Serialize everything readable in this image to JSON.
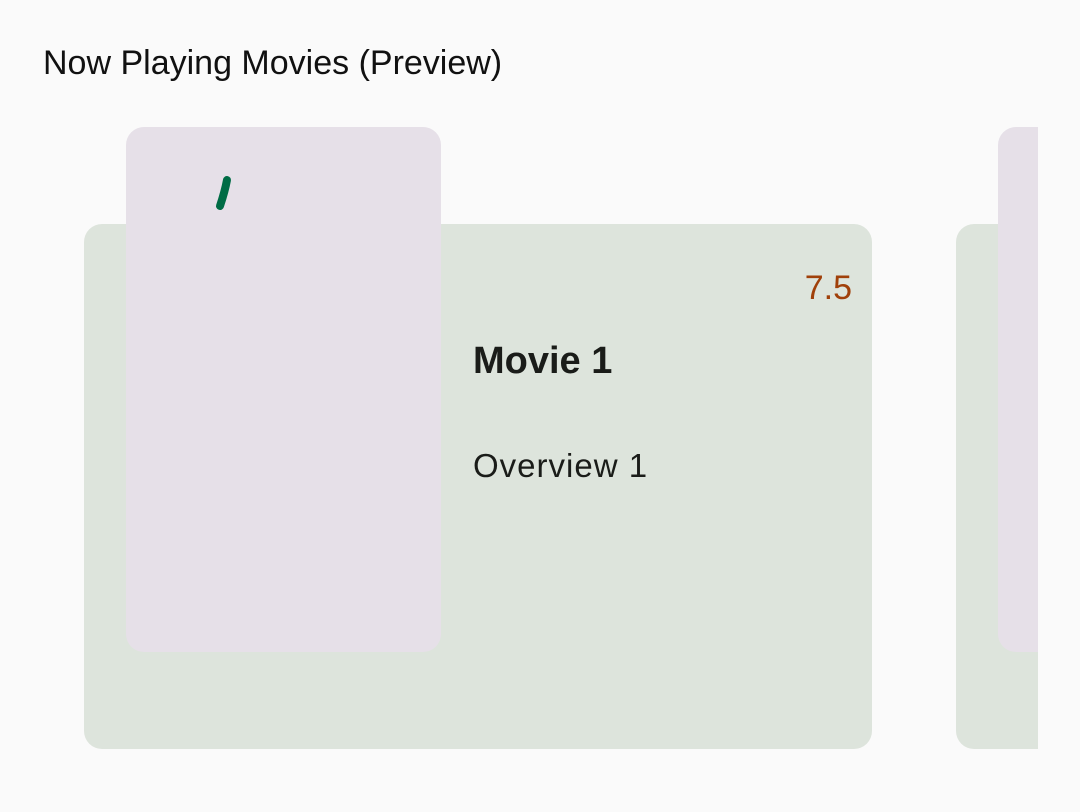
{
  "screen": {
    "title": "Now Playing Movies (Preview)"
  },
  "movies": [
    {
      "title": "Movie 1",
      "overview": "Overview 1",
      "rating": "7.5"
    }
  ],
  "colors": {
    "background": "#FAFAFA",
    "card": "#DDE4DC",
    "poster_placeholder": "#E6E0E8",
    "rating": "#A0400A",
    "spinner": "#006C45",
    "text": "#1A1C19"
  },
  "icons": {
    "poster_loading": "progress-spinner-icon"
  }
}
